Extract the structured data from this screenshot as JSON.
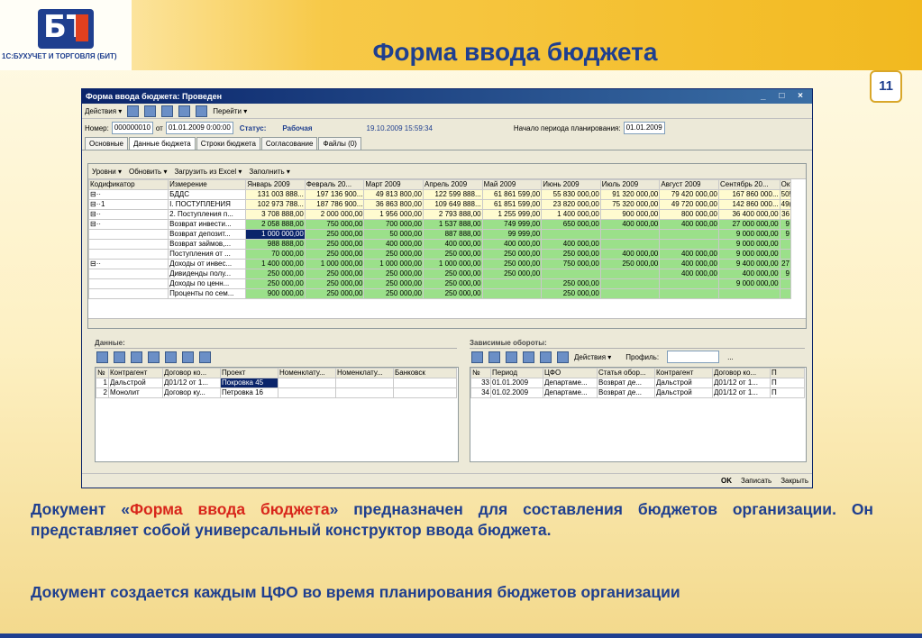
{
  "slide": {
    "logo_text": "1С:БУХУЧЕТ И ТОРГОВЛЯ (БИТ)",
    "logo_mark": "БТ",
    "title": "Форма ввода бюджета",
    "page_number": "11"
  },
  "window": {
    "title": "Форма ввода бюджета: Проведен",
    "controls": "_ □ ×",
    "toolbar": {
      "actions": "Действия ▾",
      "goto": "Перейти ▾"
    },
    "header": {
      "number_label": "Номер:",
      "number": "000000010",
      "from_label": "от",
      "date": "01.01.2009 0:00:00",
      "status_label": "Статус:",
      "status": "Рабочая",
      "timestamp": "19.10.2009 15:59:34",
      "period_label": "Начало периода планирования:",
      "period": "01.01.2009"
    },
    "tabs": [
      "Основные",
      "Данные бюджета",
      "Строки бюджета",
      "Согласование",
      "Файлы (0)"
    ],
    "subtoolbar": {
      "levels": "Уровни ▾",
      "refresh": "Обновить ▾",
      "load": "Загрузить из Excel ▾",
      "fill": "Заполнить ▾"
    },
    "grid": {
      "columns": [
        "Кодификатор",
        "Измерение",
        "Январь 2009",
        "Февраль 20...",
        "Март 2009",
        "Апрель 2009",
        "Май 2009",
        "Июнь 2009",
        "Июль 2009",
        "Август 2009",
        "Сентябрь 20...",
        "Окт"
      ],
      "rows": [
        {
          "code": "⊟··",
          "dim": "БДДС",
          "cells": [
            "131 003 888...",
            "197 136 900...",
            "49 813 800,00",
            "122 599 888...",
            "61 861 599,00",
            "55 830 000,00",
            "91 320 000,00",
            "79 420 000,00",
            "167 860 000...",
            "50!"
          ]
        },
        {
          "code": "  ⊟··1",
          "dim": "I. ПОСТУПЛЕНИЯ",
          "cells": [
            "102 973 788...",
            "187 786 900...",
            "36 863 800,00",
            "109 649 888...",
            "61 851 599,00",
            "23 820 000,00",
            "75 320 000,00",
            "49 720 000,00",
            "142 860 000...",
            "49("
          ]
        },
        {
          "code": "      ⊟··",
          "dim": "2. Поступления п...",
          "cells": [
            "3 708 888,00",
            "2 000 000,00",
            "1 956 000,00",
            "2 793 888,00",
            "1 255 999,00",
            "1 400 000,00",
            "900 000,00",
            "800 000,00",
            "36 400 000,00",
            "36"
          ]
        },
        {
          "code": "          ⊟··",
          "dim": "Возврат инвести...",
          "cells": [
            "2 058 888,00",
            "750 000,00",
            "700 000,00",
            "1 537 888,00",
            "749 999,00",
            "650 000,00",
            "400 000,00",
            "400 000,00",
            "27 000 000,00",
            "9"
          ]
        },
        {
          "code": "",
          "dim": "Возврат депозит...",
          "cells": [
            "1 000 000,00",
            "250 000,00",
            "50 000,00",
            "887 888,00",
            "99 999,00",
            "",
            "",
            "",
            "9 000 000,00",
            "9"
          ]
        },
        {
          "code": "",
          "dim": "Возврат займов,...",
          "cells": [
            "988 888,00",
            "250 000,00",
            "400 000,00",
            "400 000,00",
            "400 000,00",
            "400 000,00",
            "",
            "",
            "9 000 000,00",
            ""
          ]
        },
        {
          "code": "",
          "dim": "Поступления от ...",
          "cells": [
            "70 000,00",
            "250 000,00",
            "250 000,00",
            "250 000,00",
            "250 000,00",
            "250 000,00",
            "400 000,00",
            "400 000,00",
            "9 000 000,00",
            ""
          ]
        },
        {
          "code": "          ⊟··",
          "dim": "Доходы от инвес...",
          "cells": [
            "1 400 000,00",
            "1 000 000,00",
            "1 000 000,00",
            "1 000 000,00",
            "250 000,00",
            "750 000,00",
            "250 000,00",
            "400 000,00",
            "9 400 000,00",
            "27"
          ]
        },
        {
          "code": "",
          "dim": "Дивиденды полу...",
          "cells": [
            "250 000,00",
            "250 000,00",
            "250 000,00",
            "250 000,00",
            "250 000,00",
            "",
            "",
            "400 000,00",
            "400 000,00",
            "9"
          ]
        },
        {
          "code": "",
          "dim": "Доходы по ценн...",
          "cells": [
            "250 000,00",
            "250 000,00",
            "250 000,00",
            "250 000,00",
            "",
            "250 000,00",
            "",
            "",
            "9 000 000,00",
            ""
          ]
        },
        {
          "code": "",
          "dim": "Проценты по сем...",
          "cells": [
            "900 000,00",
            "250 000,00",
            "250 000,00",
            "250 000,00",
            "",
            "250 000,00",
            "",
            "",
            "",
            ""
          ]
        }
      ]
    },
    "data_section": {
      "label": "Данные:",
      "columns": [
        "№",
        "Контрагент",
        "Договор ко...",
        "Проект",
        "Номенклату...",
        "Номенклату...",
        "Банковск"
      ],
      "rows": [
        [
          "1",
          "Дальстрой",
          "Д01/12 от 1...",
          "Покровка 45",
          "",
          "",
          ""
        ],
        [
          "2",
          "Монолит",
          "Договор ку...",
          "Петровка 16",
          "",
          "",
          ""
        ]
      ]
    },
    "dep_section": {
      "label": "Зависимые обороты:",
      "actions": "Действия ▾",
      "profile_label": "Профиль:",
      "profile_btn": "...",
      "columns": [
        "№",
        "Период",
        "ЦФО",
        "Статья обор...",
        "Контрагент",
        "Договор ко...",
        "П"
      ],
      "rows": [
        [
          "33",
          "01.01.2009",
          "Департаме...",
          "Возврат де...",
          "Дальстрой",
          "Д01/12 от 1...",
          "П"
        ],
        [
          "34",
          "01.02.2009",
          "Департаме...",
          "Возврат де...",
          "Дальстрой",
          "Д01/12 от 1...",
          "П"
        ]
      ]
    },
    "statusbar": {
      "ok": "OK",
      "save": "Записать",
      "close": "Закрыть"
    }
  },
  "text": {
    "p1_a": "Документ «",
    "p1_hl": "Форма ввода бюджета",
    "p1_b": "» предназначен для составления бюджетов организации. Он представляет собой универсальный конструктор ввода бюджета.",
    "p2": "Документ создается каждым ЦФО во время планирования бюджетов организации"
  },
  "colors": {
    "brand": "#1f3f8f",
    "accent": "#d8261b",
    "yellow_cell": "#fffbd0",
    "green_cell": "#9be08a"
  }
}
